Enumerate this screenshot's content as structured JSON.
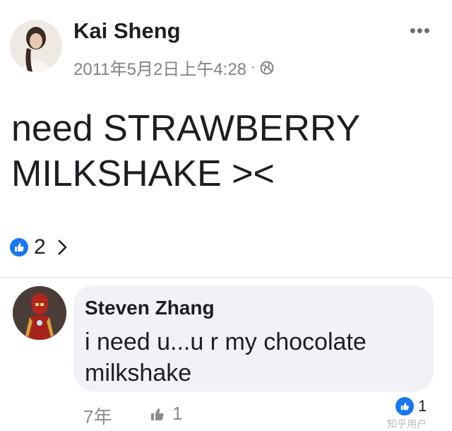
{
  "post": {
    "author": "Kai Sheng",
    "timestamp": "2011年5月2日上午4:28",
    "separator": "·",
    "audience_icon": "globe-icon",
    "more_icon": "ellipsis-icon",
    "more_label": "•••",
    "text": "need STRAWBERRY MILKSHAKE ><",
    "reactions": {
      "icon": "like-icon",
      "count": "2",
      "chevron": ">"
    }
  },
  "comment": {
    "author": "Steven Zhang",
    "text": "i need u...u r my chocolate milkshake",
    "time": "7年",
    "like_count": "1",
    "reaction_count": "1"
  },
  "watermark": "知乎用户",
  "colors": {
    "accent": "#1877f2",
    "bubble": "#f0f2f5",
    "meta": "#7f8389"
  }
}
